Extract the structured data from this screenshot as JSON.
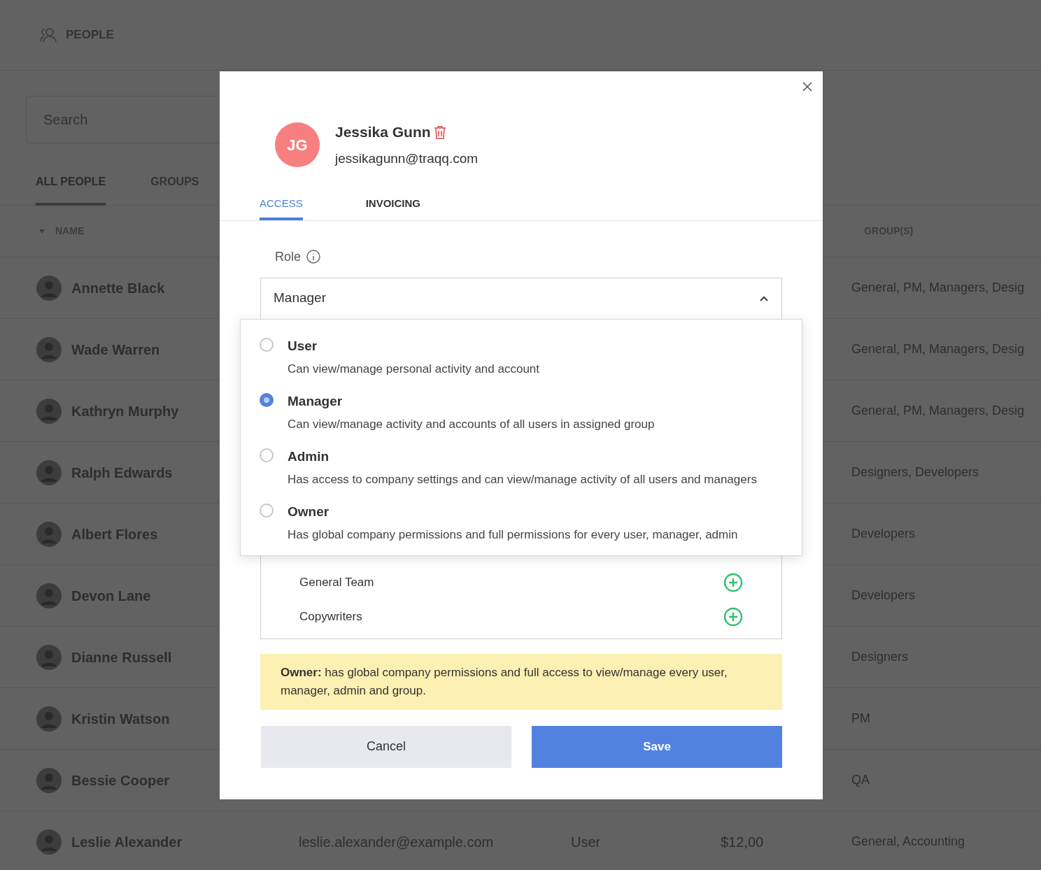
{
  "header": {
    "title": "PEOPLE"
  },
  "search": {
    "placeholder": "Search"
  },
  "tabs": [
    {
      "label": "ALL PEOPLE",
      "selected": true
    },
    {
      "label": "GROUPS",
      "selected": false
    }
  ],
  "table": {
    "columns": [
      "NAME",
      "GROUP(S)"
    ],
    "rows": [
      {
        "name": "Annette Black",
        "groups": "General, PM, Managers, Desig"
      },
      {
        "name": "Wade Warren",
        "groups": "General, PM, Managers, Desig"
      },
      {
        "name": "Kathryn Murphy",
        "groups": "General, PM, Managers, Desig"
      },
      {
        "name": "Ralph Edwards",
        "groups": "Designers, Developers"
      },
      {
        "name": "Albert Flores",
        "groups": "Developers"
      },
      {
        "name": "Devon Lane",
        "groups": "Developers"
      },
      {
        "name": "Dianne Russell",
        "groups": "Designers"
      },
      {
        "name": "Kristin Watson",
        "groups": "PM"
      },
      {
        "name": "Bessie Cooper",
        "groups": "QA"
      },
      {
        "name": "Leslie Alexander",
        "email": "leslie.alexander@example.com",
        "role": "User",
        "rate": "$12,00",
        "groups": "General, Accounting"
      }
    ]
  },
  "modal": {
    "initials": "JG",
    "name": "Jessika Gunn",
    "email": "jessikagunn@traqq.com",
    "tabs": [
      {
        "label": "ACCESS",
        "selected": true
      },
      {
        "label": "INVOICING",
        "selected": false
      }
    ],
    "role_label": "Role",
    "role_value": "Manager",
    "expanded": true,
    "options": [
      {
        "title": "User",
        "description": "Can view/manage personal activity and account",
        "selected": false
      },
      {
        "title": "Manager",
        "description": "Can view/manage activity and accounts of all users in assigned group",
        "selected": true
      },
      {
        "title": "Admin",
        "description": "Has access to company settings and can view/manage activity of all users and managers",
        "selected": false
      },
      {
        "title": "Owner",
        "description": "Has global company permissions and full permissions for every user, manager, admin",
        "selected": false
      }
    ],
    "groups": [
      "General Team",
      "Copywriters"
    ],
    "notice": "**Owner:** has global company permissions and full access to view/manage every user, manager, admin and group.",
    "cancel": "Cancel",
    "save": "Save"
  }
}
